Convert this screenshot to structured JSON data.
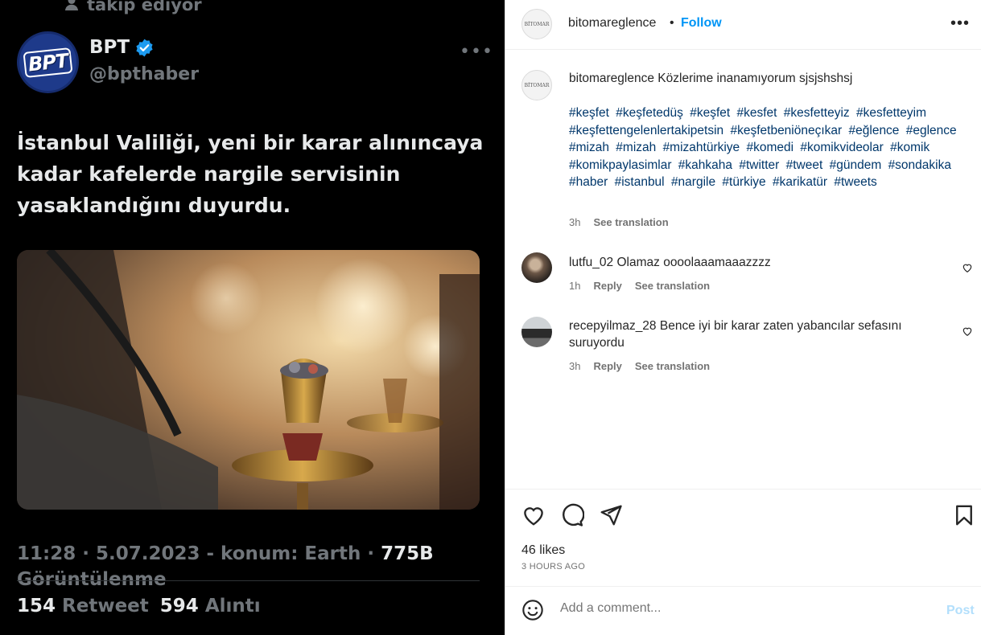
{
  "tweet": {
    "follow_note": "takip ediyor",
    "author_name": "BPT",
    "author_handle": "@bpthaber",
    "avatar_logo": "BPT",
    "text": "İstanbul Valiliği, yeni bir karar alınıncaya kadar kafelerde nargile servisinin yasaklandığını duyurdu.",
    "meta": "11:28 · 5.07.2023 - konum: Earth · ",
    "views": "775B",
    "views_label": "Görüntülenme",
    "retweet_count": "154",
    "retweet_label": "Retweet",
    "quote_count": "594",
    "quote_label": "Alıntı",
    "icons": [
      "person-icon",
      "verified-badge-icon",
      "more-icon"
    ]
  },
  "post": {
    "username": "bitomareglence",
    "avatar_text": "BİTOMAR",
    "follow_label": "Follow",
    "caption_text": "Közlerime inanamıyorum sjsjshshsj",
    "hashtags": [
      "#keşfet",
      "#keşfetedüş",
      "#keşfet",
      "#kesfet",
      "#kesfetteyiz",
      "#kesfetteyim",
      "#keşfettengelenlertakipetsin",
      "#keşfetbeniöneçıkar",
      "#eğlence",
      "#eglence",
      "#mizah",
      "#mizah",
      "#mizahtürkiye",
      "#komedi",
      "#komikvideolar",
      "#komik",
      "#komikpaylasimlar",
      "#kahkaha",
      "#twitter",
      "#tweet",
      "#gündem",
      "#sondakika",
      "#haber",
      "#istanbul",
      "#nargile",
      "#türkiye",
      "#karikatür",
      "#tweets"
    ],
    "caption_time": "3h",
    "see_translation": "See translation",
    "comments": [
      {
        "username": "lutfu_02",
        "text": "Olamaz oooolaaamaaazzzz",
        "time": "1h",
        "reply": "Reply",
        "translate": "See translation"
      },
      {
        "username": "recepyilmaz_28",
        "text": "Bence iyi bir karar zaten yabancılar sefasını suruyordu",
        "time": "3h",
        "reply": "Reply",
        "translate": "See translation"
      }
    ],
    "likes": "46 likes",
    "time_ago": "3 HOURS AGO",
    "comment_placeholder": "Add a comment...",
    "post_label": "Post",
    "colors": {
      "accent": "#0095f6",
      "hashtag": "#00376b",
      "post_disabled": "#b2dffc"
    }
  }
}
